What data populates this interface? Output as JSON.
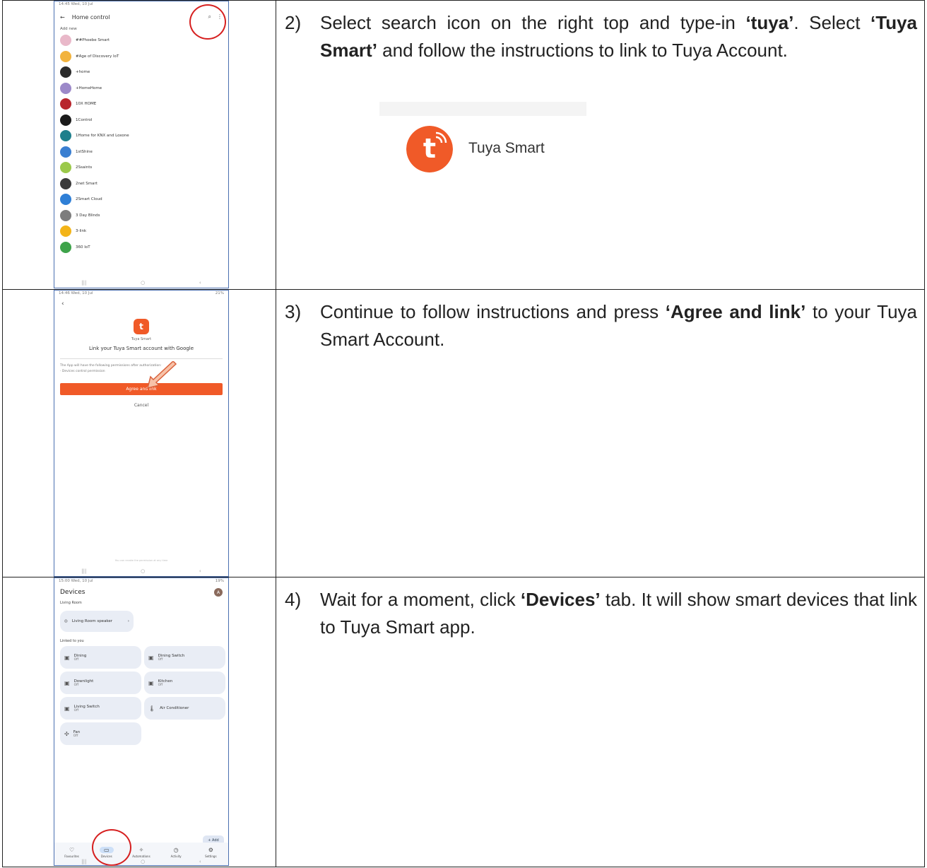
{
  "rows": [
    {
      "number": "2)",
      "text_parts": [
        {
          "t": "Select search icon on the right top and type-in ",
          "b": false
        },
        {
          "t": "‘tuya’",
          "b": true
        },
        {
          "t": ". Select ",
          "b": false
        },
        {
          "t": "‘Tuya Smart’",
          "b": true
        },
        {
          "t": " and follow the instructions to link to Tuya Account.",
          "b": false
        }
      ],
      "banner_label": "Tuya Smart"
    },
    {
      "number": "3)",
      "text_parts": [
        {
          "t": "Continue to follow instructions and press ",
          "b": false
        },
        {
          "t": "‘Agree and link’",
          "b": true
        },
        {
          "t": " to your Tuya Smart Account.",
          "b": false
        }
      ]
    },
    {
      "number": "4)",
      "text_parts": [
        {
          "t": "Wait for a moment, click ",
          "b": false
        },
        {
          "t": "‘Devices’",
          "b": true
        },
        {
          "t": " tab. It will show smart devices that link to Tuya Smart app.",
          "b": false
        }
      ]
    }
  ],
  "screen1": {
    "status_time": "14:45  Wed, 10 Jul",
    "title": "Home control",
    "subheader": "Add new",
    "items": [
      {
        "label": "##Phoebe Smart",
        "color": "#e9b8c9"
      },
      {
        "label": "#Age of Discovery IoT",
        "color": "#f2b33d"
      },
      {
        "label": "+home",
        "color": "#2b2b2b"
      },
      {
        "label": "+HomeHome",
        "color": "#9c89c9"
      },
      {
        "label": "10X HOME",
        "color": "#b8262d"
      },
      {
        "label": "1Control",
        "color": "#1a1a1a"
      },
      {
        "label": "1Home for KNX and Loxone",
        "color": "#1f7f8c"
      },
      {
        "label": "1stShine",
        "color": "#3a7fd1"
      },
      {
        "label": "2Ssaints",
        "color": "#9bc94a"
      },
      {
        "label": "2net Smart",
        "color": "#3a3a3a"
      },
      {
        "label": "2Smart Cloud",
        "color": "#2f7fd6"
      },
      {
        "label": "3 Day Blinds",
        "color": "#7d7d7d"
      },
      {
        "label": "3-link",
        "color": "#f3b418"
      },
      {
        "label": "360 IoT",
        "color": "#3ea34a"
      }
    ]
  },
  "screen2": {
    "status_time": "14:46  Wed, 10 Jul",
    "status_right": "21%",
    "brand": "Tuya Smart",
    "title": "Link your Tuya Smart account with Google",
    "perm_line1": "The App will have the following permissions after authorization:",
    "perm_line2": "· Devices control permission",
    "agree": "Agree and link",
    "cancel": "Cancel",
    "footer": "You can revoke the permission at any time"
  },
  "screen3": {
    "status_time": "15:00  Wed, 10 Jul",
    "status_right": "19%",
    "title": "Devices",
    "avatar": "A",
    "room": "Living Room",
    "speaker": "Living Room speaker",
    "linked_label": "Linked to you",
    "devices": [
      {
        "name": "Dining",
        "state": "Off",
        "icon": "▣"
      },
      {
        "name": "Dining Switch",
        "state": "Off",
        "icon": "▣"
      },
      {
        "name": "Downlight",
        "state": "Off",
        "icon": "▣"
      },
      {
        "name": "Kitchen",
        "state": "Off",
        "icon": "▣"
      },
      {
        "name": "Living Switch",
        "state": "Off",
        "icon": "▣"
      },
      {
        "name": "Air Conditioner",
        "state": "",
        "icon": "🌡"
      },
      {
        "name": "Fan",
        "state": "Off",
        "icon": "✣"
      }
    ],
    "add": "+ Add",
    "tabs": [
      {
        "label": "Favourites",
        "icon": "♡"
      },
      {
        "label": "Devices",
        "icon": "▭"
      },
      {
        "label": "Automations",
        "icon": "✧"
      },
      {
        "label": "Activity",
        "icon": "◷"
      },
      {
        "label": "Settings",
        "icon": "⚙"
      }
    ]
  }
}
